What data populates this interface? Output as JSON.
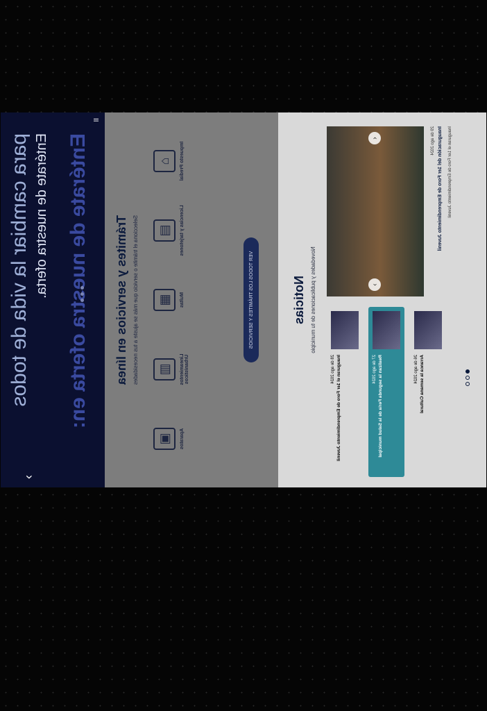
{
  "hero": {
    "line1": "para cambiar la vida de todos",
    "line2": "Entérate de nuestra oferta.",
    "line3": "Entérate de nuestra oferta en:",
    "next_label": "›",
    "pause_label": "II"
  },
  "tramites": {
    "title": "Trámites y servicios en línea",
    "subtitle": "Selecciona el trámite o servicio que más se ajuste a tus necesidades",
    "services": [
      {
        "label": "Impuesto Predial",
        "icon": "house-icon"
      },
      {
        "label": "Licencias y tarjetones",
        "icon": "store-icon"
      },
      {
        "label": "Multas",
        "icon": "building-icon"
      },
      {
        "label": "Lineamientos Urbanísticos",
        "icon": "city-icon"
      },
      {
        "label": "Aparatos",
        "icon": "document-icon"
      }
    ],
    "button_label": "VER TODOS LOS TRÁMITES Y SERVICIOS"
  },
  "noticias": {
    "title": "Noticias",
    "subtitle": "Novedades y publicaciones de tu municipio",
    "feature": {
      "date": "29 de ago 2024",
      "title": "Inauguración del 1er Foro de Emprendimiento Juvenil",
      "desc": "Inauguran el 1er Foro de Emprendimiento Juvenil"
    },
    "items": [
      {
        "date": "28 de ago 2024",
        "title": "Inauguran el 1er Foro de Emprendimiento Juvenil"
      },
      {
        "date": "27 de ago 2024",
        "title": "Realizan la segunda Feria de la Salud municipal"
      },
      {
        "date": "26 de ago 2024",
        "title": "Arranca la semana Cultural"
      }
    ]
  }
}
